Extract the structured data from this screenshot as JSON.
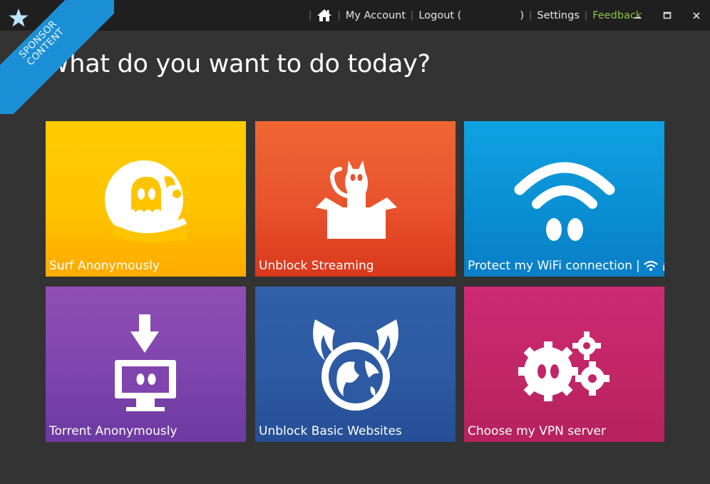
{
  "sponsor": {
    "line1": "SPONSOR",
    "line2": "CONTENT",
    "color": "#1b8fd6"
  },
  "nav": {
    "home_icon": "home-icon",
    "my_account": "My Account",
    "logout": "Logout (",
    "logout_close": ")",
    "settings": "Settings",
    "feedback": "Feedback",
    "feedback_color": "#8cc63f"
  },
  "window_controls": {
    "minimize": "minimize-icon",
    "maximize": "maximize-icon",
    "close": "close-icon"
  },
  "headline": "What do you want to do today?",
  "tiles": [
    {
      "label": "Surf Anonymously",
      "icon": "ghost-icon",
      "color": "#ffc400"
    },
    {
      "label": "Unblock Streaming",
      "icon": "cat-in-box-icon",
      "color": "#e8532e"
    },
    {
      "label": "Protect my WiFi connection",
      "separator": "|",
      "icon": "wifi-ghost-icon",
      "color": "#0a8fd3"
    },
    {
      "label": "Torrent Anonymously",
      "icon": "download-monitor-icon",
      "color": "#7f44ad"
    },
    {
      "label": "Unblock Basic Websites",
      "icon": "winged-globe-icon",
      "color": "#2d5aa2"
    },
    {
      "label": "Choose my VPN server",
      "icon": "gears-icon",
      "color": "#c22667"
    }
  ]
}
